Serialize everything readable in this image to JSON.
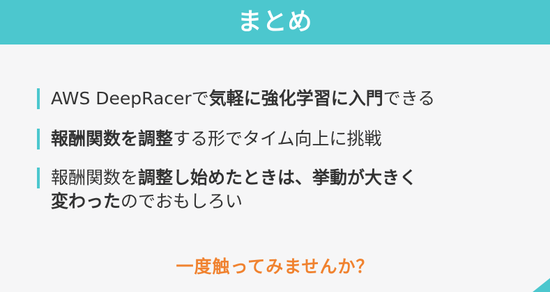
{
  "header": {
    "title": "まとめ"
  },
  "bullets": [
    {
      "parts": [
        "AWS DeepRacerで",
        "気軽に強化学習に入門",
        "できる"
      ]
    },
    {
      "parts": [
        "報酬関数を調整",
        "する形でタイム向上に挑戦"
      ]
    },
    {
      "parts": [
        "報酬関数を",
        "調整し始めたときは、挙動が大きく",
        "変わった",
        "のでおもしろい"
      ]
    }
  ],
  "cta": "一度触ってみませんか？",
  "colors": {
    "accent": "#4cc7ce",
    "cta": "#f0822f",
    "text": "#333333",
    "background": "#f6f6f7"
  }
}
